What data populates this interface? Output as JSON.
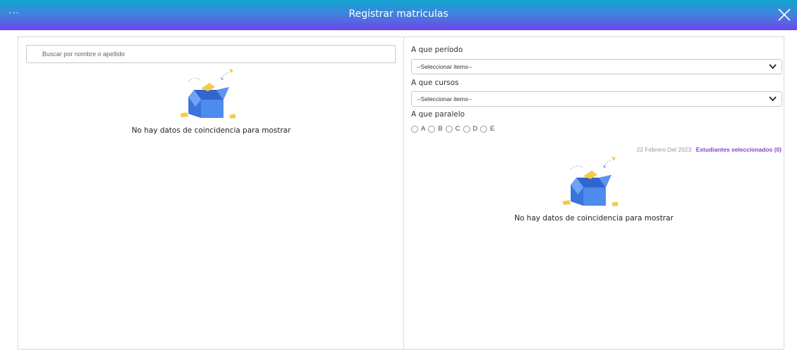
{
  "window": {
    "title": "Registrar matriculas",
    "menu_label": "···"
  },
  "search": {
    "placeholder": "Buscar por nombre o apellido"
  },
  "left_panel": {
    "empty_message": "No hay datos de coincidencia para mostrar"
  },
  "form": {
    "periodo_label": "A que período",
    "periodo_value": "--Seleccionar items--",
    "cursos_label": "A que cursos",
    "cursos_value": "--Seleccionar items--",
    "paralelo_label": "A que paralelo",
    "paralelos": [
      "A",
      "B",
      "C",
      "D",
      "E"
    ]
  },
  "right_panel": {
    "date": "22 Febrero Del 2023",
    "selected_label": "Estudiantes seleccionados (0)",
    "empty_message": "No hay datos de coincidencia para mostrar"
  },
  "colors": {
    "accent_purple": "#8a3fd6",
    "titlebar_start": "#13a6cf",
    "titlebar_end": "#6d46ea",
    "box_blue": "#3f7fe0"
  }
}
